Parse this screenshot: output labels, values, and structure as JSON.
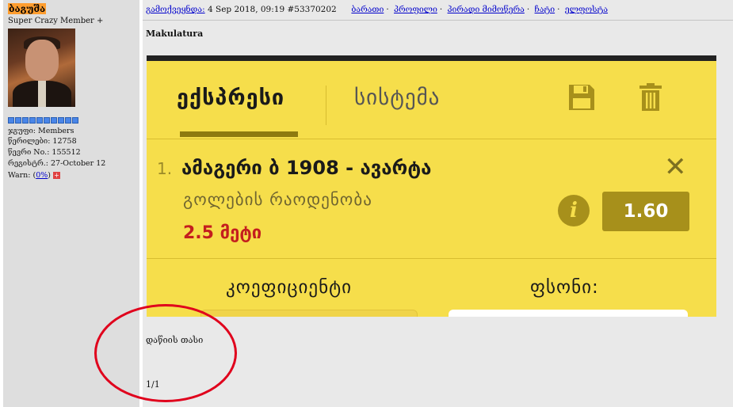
{
  "user": {
    "name": "ბაგუშა",
    "rank": "Super Crazy Member +",
    "pips": 10,
    "group_label": "ჯგუფი: Members",
    "posts_label": "წერილები: 12758",
    "number_label": "წევრი No.: 155512",
    "registered_label": "რეგისტრ.: 27-October 12",
    "warn_label": "Warn: (",
    "warn_value": "0%",
    "warn_close": ")",
    "warn_button": "+"
  },
  "post": {
    "published_label": "გამოქვეყნდა:",
    "date": "4 Sep 2018, 09:19",
    "id": "#53370202",
    "actions": [
      "ბარათი",
      "პროფილი",
      "პირადი მიმოწერა",
      "ჩატი",
      "ელფოსტა"
    ],
    "title": "Makulatura",
    "text": "დაწიის თასი",
    "page": "1/1"
  },
  "betslip": {
    "tab_active": "ექსპრესი",
    "tab_inactive": "სისტემა",
    "icons": [
      "save-icon",
      "trash-icon"
    ],
    "selection_number": "1.",
    "match": "ამაგერი ბ 1908 - ავარტა",
    "market": "გოლების რაოდენობა",
    "pick": "2.5 მეტი",
    "odds": "1.60",
    "close_symbol": "✕",
    "info_symbol": "i",
    "coef_label": "კოეფიციენტი",
    "stake_label": "ფსონი:",
    "colors": {
      "panel": "#f6de4b",
      "dark_accent": "#a7901b",
      "pick_red": "#c41e1e",
      "annotation_red": "#e0001c"
    }
  }
}
